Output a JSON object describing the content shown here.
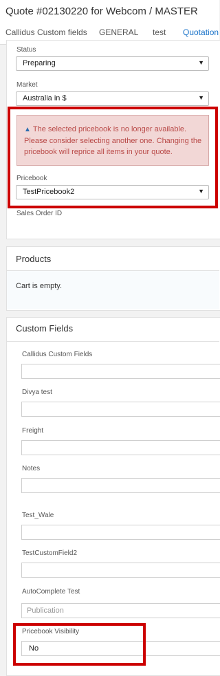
{
  "header": {
    "title": "Quote #02130220 for Webcom / MASTER",
    "tabs": [
      {
        "label": "Callidus Custom fields"
      },
      {
        "label": "GENERAL"
      },
      {
        "label": "test"
      },
      {
        "label": "Quotation"
      }
    ]
  },
  "general": {
    "status_label": "Status",
    "status_value": "Preparing",
    "market_label": "Market",
    "market_value": "Australia in $",
    "alert_text": "The selected pricebook is no longer available. Please consider selecting another one. Changing the pricebook will reprice all items in your quote.",
    "pricebook_label": "Pricebook",
    "pricebook_value": "TestPricebook2",
    "sales_order_label": "Sales Order ID"
  },
  "products": {
    "title": "Products",
    "empty_text": "Cart is empty."
  },
  "custom_fields": {
    "title": "Custom Fields",
    "fields": [
      {
        "label": "Callidus Custom Fields",
        "value": ""
      },
      {
        "label": "Divya test",
        "value": ""
      },
      {
        "label": "Freight",
        "value": ""
      },
      {
        "label": "Notes",
        "value": ""
      },
      {
        "label": "Test_Wale",
        "value": ""
      },
      {
        "label": "TestCustomField2",
        "value": ""
      },
      {
        "label": "AutoComplete Test",
        "placeholder": "Publication"
      },
      {
        "label": "Pricebook Visibility",
        "value": "No"
      }
    ]
  },
  "colors": {
    "accent": "#1a73c9",
    "alert_bg": "#f2d7d6",
    "alert_text": "#b94a48",
    "highlight": "#cc0000"
  },
  "icons": {
    "alert": "warning-icon",
    "dropdown": "chevron-down-icon"
  }
}
